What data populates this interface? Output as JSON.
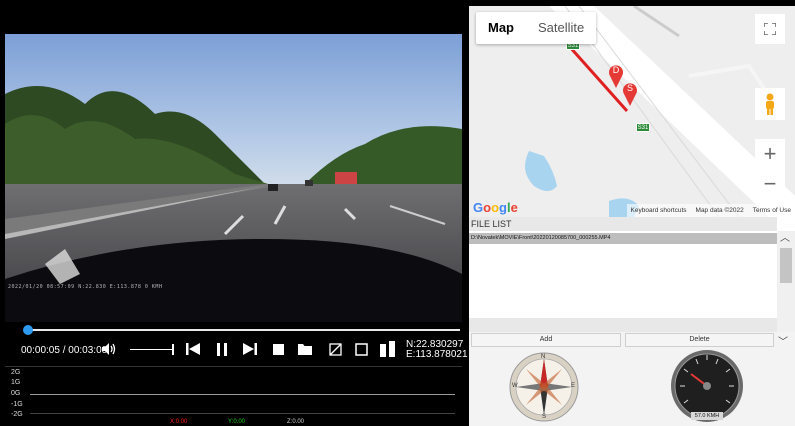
{
  "player": {
    "osd": "2022/01/20  08:57:09  N:22.830  E:113.878  0 KMH",
    "elapsed": "00:00:05",
    "separator": " / ",
    "duration": "00:03:00",
    "progress_fraction": 0.01,
    "volume_fraction": 1.0,
    "lat": "N:22.830297",
    "lon": "E:113.878021"
  },
  "gsensor": {
    "y_labels": [
      "2G",
      "1G",
      "0G",
      "-1G",
      "-2G"
    ],
    "legend": [
      {
        "label": "X:0.00",
        "color": "#ff2020"
      },
      {
        "label": "Y:0.00",
        "color": "#20d020"
      },
      {
        "label": "Z:0.00",
        "color": "#d0d0d0"
      }
    ]
  },
  "map": {
    "tabs": [
      "Map",
      "Satellite"
    ],
    "active_tab": "Map",
    "road_shield": "S31",
    "markers": [
      "D",
      "S"
    ],
    "logo": "Google",
    "footer": [
      "Keyboard shortcuts",
      "Map data ©2022",
      "Terms of Use"
    ],
    "zoom_in": "+",
    "zoom_out": "−"
  },
  "file_list": {
    "header": "FILE LIST",
    "files": [
      "D:\\Novatek\\MOVIE\\Front\\20220120085700_000255.MP4"
    ],
    "selected_index": 0
  },
  "buttons": {
    "add": "Add",
    "delete": "Delete"
  },
  "gauges": {
    "speed_readout": "57.0 KMH",
    "compass_letters": [
      "N",
      "E",
      "S",
      "W"
    ]
  },
  "colors": {
    "accent": "#2f9bef",
    "marker": "#e53935",
    "route": "#e02020"
  }
}
